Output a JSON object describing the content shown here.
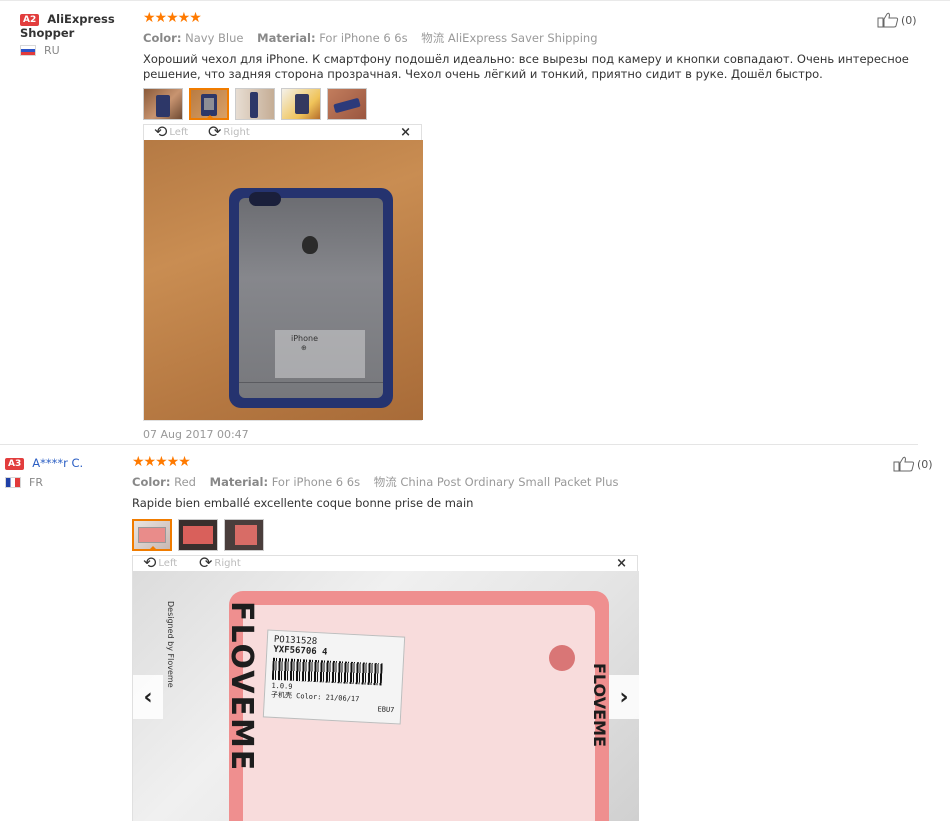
{
  "reviews": [
    {
      "level": "A2",
      "user_name_line1": "AliExpress",
      "user_name_line2": "Shopper",
      "country": "RU",
      "stars": "★★★★★",
      "color_label": "Color:",
      "color_value": "Navy Blue",
      "material_label": "Material:",
      "material_value": "For iPhone 6 6s",
      "shipping_label": "物流",
      "shipping_value": "AliExpress Saver Shipping",
      "text": "Хороший чехол для iPhone. К смартфону подошёл идеально: все вырезы под камеру и кнопки совпадают. Очень интересное решение, что задняя сторона прозрачная. Чехол очень лёгкий и тонкий, приятно сидит в руке. Дошёл быстро.",
      "rotate_left": "Left",
      "rotate_right": "Right",
      "close": "×",
      "date": "07 Aug 2017 00:47",
      "helpful_count": "(0)",
      "photo_text_model": "iPhone",
      "photo_text_sub": "⊕"
    },
    {
      "level": "A3",
      "user_name_line1": "A****r C.",
      "country": "FR",
      "stars": "★★★★★",
      "color_label": "Color:",
      "color_value": "Red",
      "material_label": "Material:",
      "material_value": "For iPhone 6 6s",
      "shipping_label": "物流",
      "shipping_value": "China Post Ordinary Small Packet Plus",
      "text": "Rapide bien emballé excellente coque bonne prise de main",
      "rotate_left": "Left",
      "rotate_right": "Right",
      "close": "×",
      "helpful_count": "(0)",
      "nav_prev": "‹",
      "nav_next": "›",
      "photo_brand": "FLOVEME",
      "photo_brand_small": "Designed by Floveme",
      "label_line1": "PO131528",
      "label_line2": "YXF56706  4",
      "label_line3": "1.0.9",
      "label_line4": "子机壳 Color:",
      "label_line5": "21/06/17",
      "label_line6": "EBU7"
    }
  ],
  "colors": {
    "star": "#ff7a00",
    "badge": "#e23d3d",
    "link": "#2a5ec4",
    "active_thumb": "#f07c00"
  },
  "icons": [
    "thumbs-up-icon",
    "rotate-left-icon",
    "rotate-right-icon",
    "close-icon",
    "chevron-left-icon",
    "chevron-right-icon",
    "star-icon",
    "flag-icon"
  ]
}
